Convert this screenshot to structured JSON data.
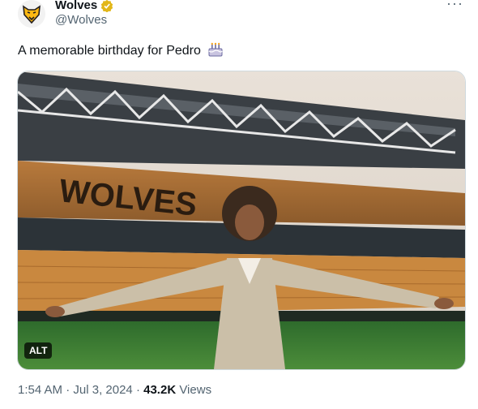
{
  "author": {
    "display_name": "Wolves",
    "handle": "@Wolves",
    "verified": true,
    "brand_color": "#FDB913"
  },
  "more_label": "···",
  "tweet": {
    "text": "A memorable birthday for Pedro",
    "emoji": "birthday-cake-icon"
  },
  "media": {
    "alt_label": "ALT",
    "stadium_lettering": "WOLVES"
  },
  "meta": {
    "time": "1:54 AM",
    "sep1": "·",
    "date": "Jul 3, 2024",
    "sep2": "·",
    "views_count": "43.2K",
    "views_label": "Views"
  }
}
